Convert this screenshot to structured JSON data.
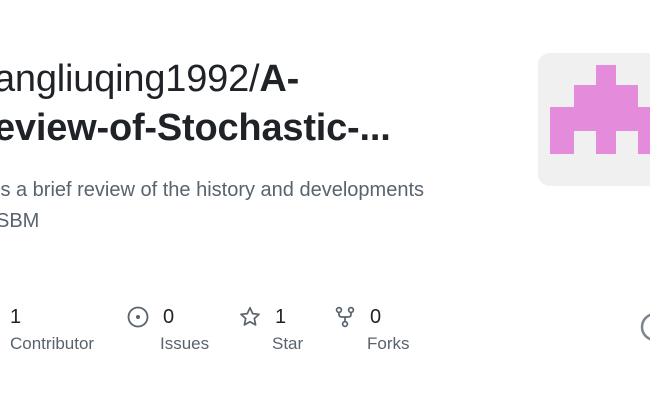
{
  "repo": {
    "owner_text": "angliuqing1992/",
    "name_line1": "A-",
    "name_line2": "eview-of-Stochastic-...",
    "description_line1": "is a brief review of the history and developments",
    "description_line2": "SBM"
  },
  "stats": {
    "contributors": {
      "count": "1",
      "label": "Contributor",
      "icon": "people-icon"
    },
    "issues": {
      "count": "0",
      "label": "Issues",
      "icon": "issue-icon"
    },
    "stars": {
      "count": "1",
      "label": "Star",
      "icon": "star-icon"
    },
    "forks": {
      "count": "0",
      "label": "Forks",
      "icon": "fork-icon"
    }
  },
  "colors": {
    "avatar_pink": "#e48bdc",
    "avatar_bg": "#f0f0f0",
    "muted_text": "#59636e",
    "title_text": "#1f2328"
  }
}
